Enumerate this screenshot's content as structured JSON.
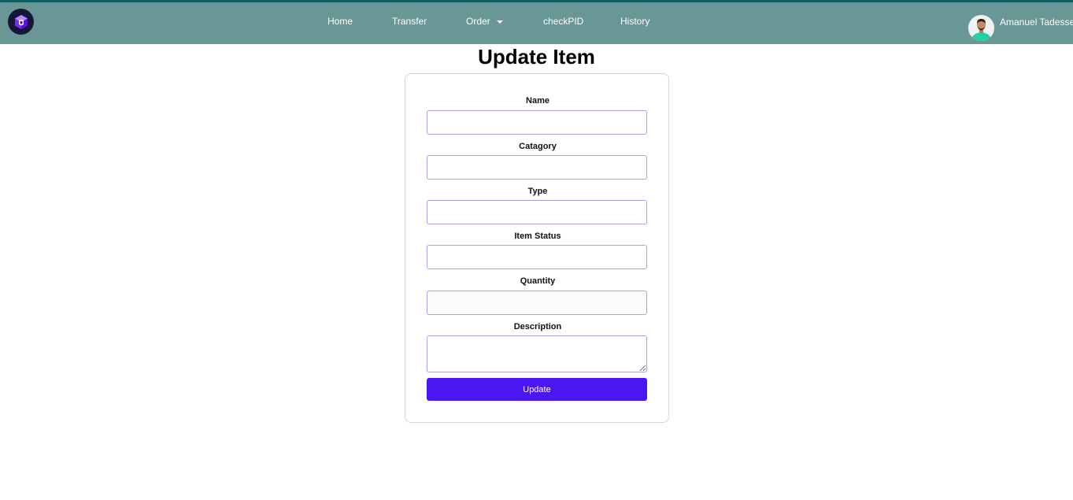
{
  "nav": {
    "links": [
      {
        "label": "Home"
      },
      {
        "label": "Transfer"
      },
      {
        "label": "Order"
      },
      {
        "label": "checkPID"
      },
      {
        "label": "History"
      }
    ],
    "user_name": "Amanuel Tadesse"
  },
  "page": {
    "title": "Update Item"
  },
  "form": {
    "fields": [
      {
        "label": "Name",
        "value": ""
      },
      {
        "label": "Catagory",
        "value": ""
      },
      {
        "label": "Type",
        "value": ""
      },
      {
        "label": "Item Status",
        "value": ""
      },
      {
        "label": "Quantity",
        "value": ""
      },
      {
        "label": "Description",
        "value": ""
      }
    ],
    "submit_label": "Update"
  },
  "colors": {
    "navbar": "#689796",
    "navbar_border": "#0c5f5f",
    "button": "#4a16f2",
    "input_border": "#a9a4e6",
    "logo_bg": "#16163a"
  },
  "icons": {
    "logo": "cube-logo-icon",
    "dropdown": "caret-down-icon",
    "avatar": "user-avatar"
  }
}
